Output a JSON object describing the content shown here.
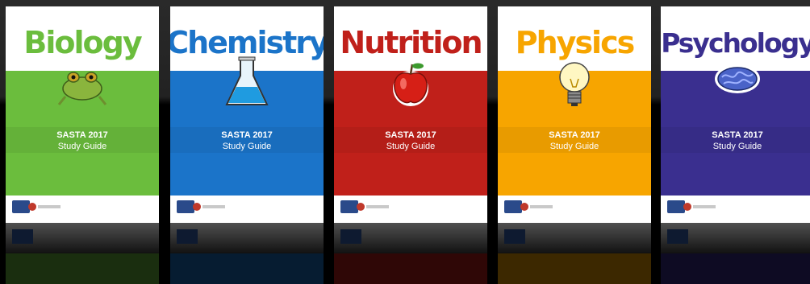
{
  "books": [
    {
      "title": "Biology",
      "subtitle": "SASTA 2017",
      "subtitle2": "Study Guide",
      "color": "#6bbd3d",
      "titleColor": "#6bbd3d",
      "icon": "frog-icon"
    },
    {
      "title": "Chemistry",
      "subtitle": "SASTA 2017",
      "subtitle2": "Study Guide",
      "color": "#1b74c9",
      "titleColor": "#1b74c9",
      "icon": "flask-icon"
    },
    {
      "title": "Nutrition",
      "subtitle": "SASTA 2017",
      "subtitle2": "Study Guide",
      "color": "#c0201a",
      "titleColor": "#c0201a",
      "icon": "apple-icon"
    },
    {
      "title": "Physics",
      "subtitle": "SASTA 2017",
      "subtitle2": "Study Guide",
      "color": "#f7a500",
      "titleColor": "#f7a500",
      "icon": "lightbulb-icon"
    },
    {
      "title": "Psychology",
      "subtitle": "SASTA 2017",
      "subtitle2": "Study Guide",
      "color": "#3a2f8f",
      "titleColor": "#3a2f8f",
      "icon": "brain-icon"
    }
  ]
}
